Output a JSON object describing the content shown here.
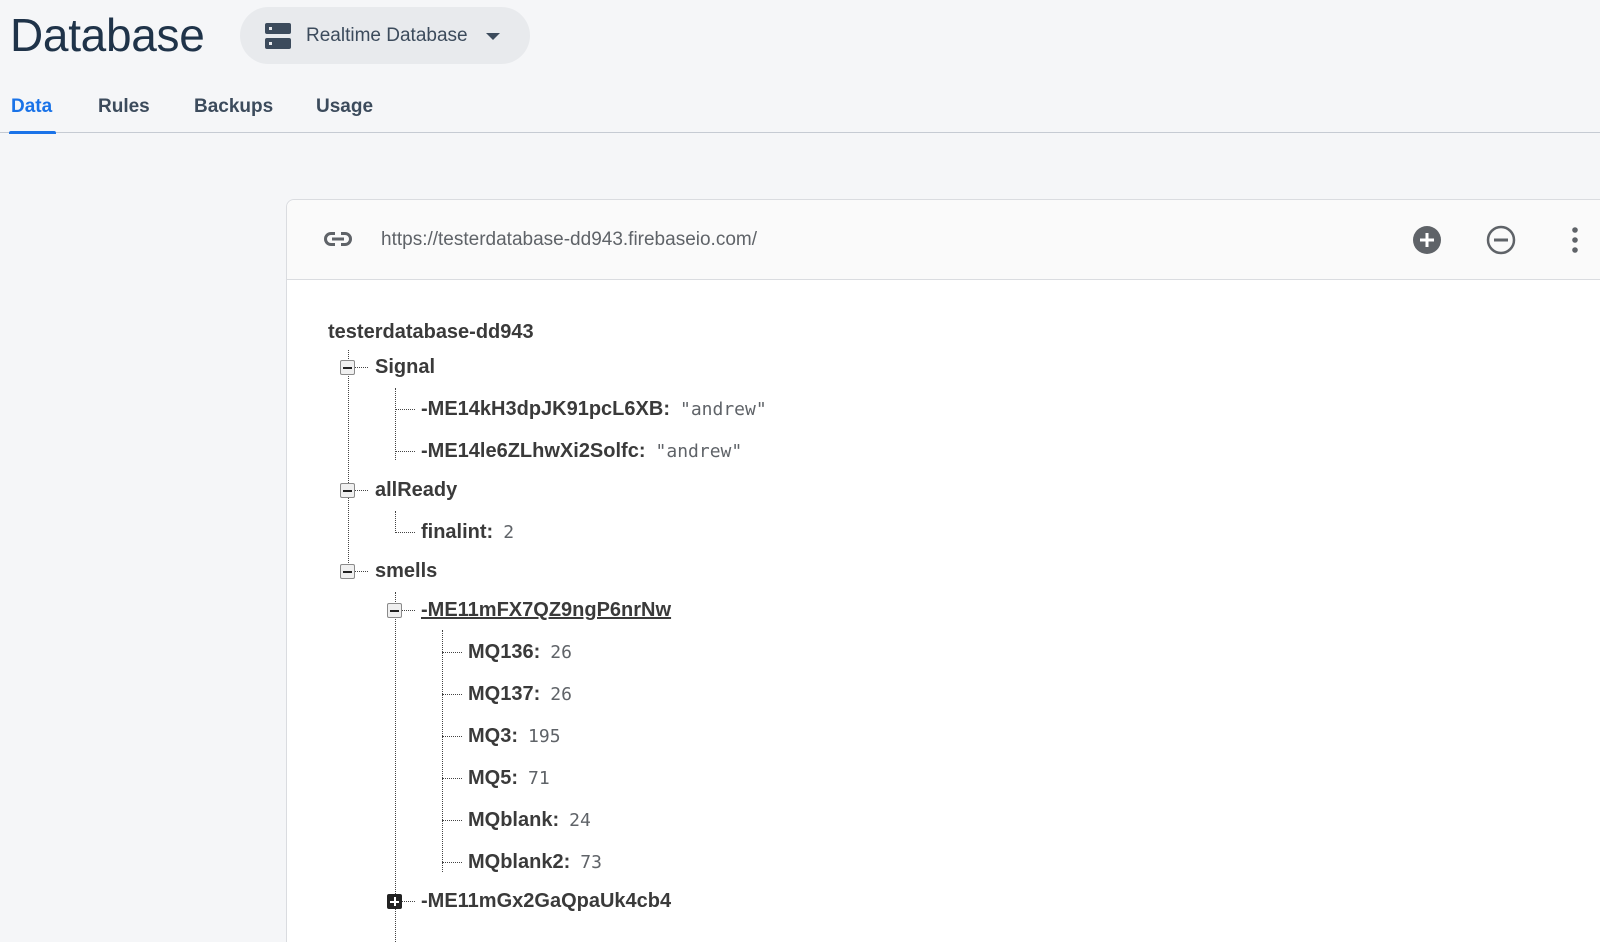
{
  "header": {
    "title": "Database",
    "db_selector": {
      "label": "Realtime Database",
      "icon": "storage-icon"
    }
  },
  "tabs": [
    {
      "label": "Data",
      "active": true
    },
    {
      "label": "Rules",
      "active": false
    },
    {
      "label": "Backups",
      "active": false
    },
    {
      "label": "Usage",
      "active": false
    }
  ],
  "toolbar": {
    "url": "https://testerdatabase-dd943.firebaseio.com/",
    "icons": [
      "link-icon",
      "add-circle-icon",
      "remove-circle-icon",
      "more-vert-icon"
    ]
  },
  "tree": {
    "root": "testerdatabase-dd943",
    "signal": {
      "key": "Signal",
      "children": [
        {
          "key": "-ME14kH3dpJK91pcL6XB",
          "value": "\"andrew\""
        },
        {
          "key": "-ME14le6ZLhwXi2Solfc",
          "value": "\"andrew\""
        }
      ]
    },
    "allready": {
      "key": "allReady",
      "children": [
        {
          "key": "finalint",
          "value": "2"
        }
      ]
    },
    "smells": {
      "key": "smells",
      "entry1": {
        "key": "-ME11mFX7QZ9ngP6nrNw",
        "children": [
          {
            "key": "MQ136",
            "value": "26"
          },
          {
            "key": "MQ137",
            "value": "26"
          },
          {
            "key": "MQ3",
            "value": "195"
          },
          {
            "key": "MQ5",
            "value": "71"
          },
          {
            "key": "MQblank",
            "value": "24"
          },
          {
            "key": "MQblank2",
            "value": "73"
          }
        ]
      },
      "entry2": {
        "key": "-ME11mGx2GaQpaUk4cb4"
      }
    },
    "colon": ":"
  },
  "colors": {
    "accent": "#1a73e8",
    "title": "#1f3349"
  }
}
